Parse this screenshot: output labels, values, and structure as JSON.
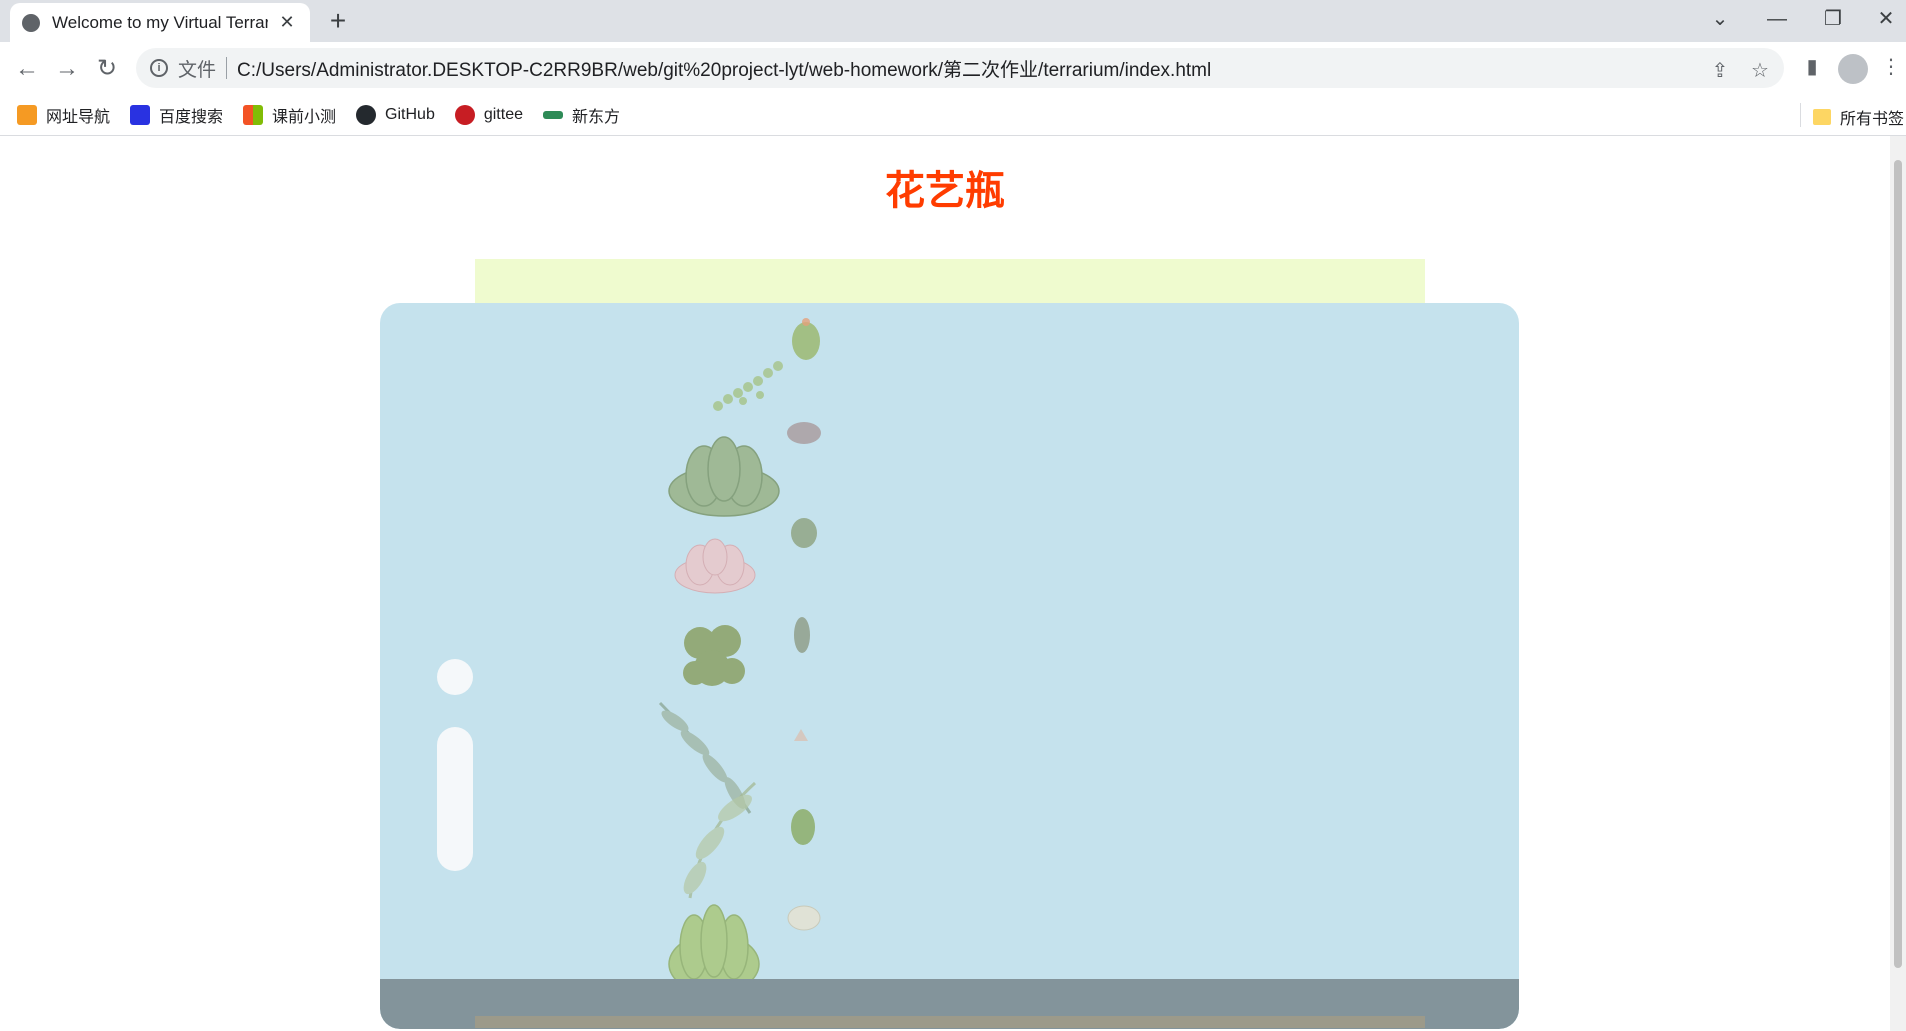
{
  "browser": {
    "tab_title": "Welcome to my Virtual Terrari",
    "tab_close": "✕",
    "new_tab": "+",
    "file_label": "文件",
    "url": "C:/Users/Administrator.DESKTOP-C2RR9BR/web/git%20project-lyt/web-homework/第二次作业/terrarium/index.html"
  },
  "bookmarks": [
    {
      "label": "网址导航",
      "color": "#f59a23"
    },
    {
      "label": "百度搜索",
      "color": "#2932e1"
    },
    {
      "label": "课前小测",
      "color": "#00a4ef"
    },
    {
      "label": "GitHub",
      "color": "#24292e"
    },
    {
      "label": "gittee",
      "color": "#c71d23"
    },
    {
      "label": "新东方",
      "color": "#2e8b57"
    }
  ],
  "bookmarks_right": "所有书签",
  "page": {
    "title": "花艺瓶"
  },
  "colors": {
    "title": "#ff3c00",
    "jar_top": "#effbcf",
    "jar_body": "#c5e2ed",
    "jar_soil": "#83949b"
  }
}
